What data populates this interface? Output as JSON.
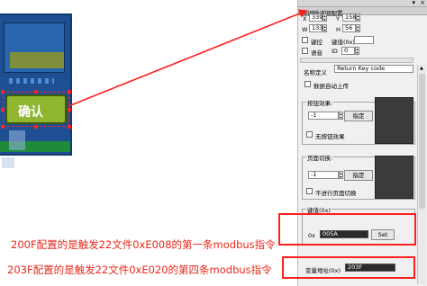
{
  "canvas": {
    "confirm_label": "确认",
    "caption_1": "200F配置的是触发22文件0xE008的第一条modbus指令",
    "caption_2": "203F配置的是触发22文件0xE020的第四条modbus指令"
  },
  "panel": {
    "pin_icon": "▾",
    "close_icon": "×",
    "title": "按键输返回配置",
    "x_label": "X",
    "x_value": "339",
    "y_label": "Y",
    "y_value": "158",
    "w_label": "W",
    "w_value": "133",
    "h_label": "H",
    "h_value": "56",
    "keyboard_label": "键控",
    "keyvalue_label": "键值(0x)",
    "voice_label": "语音",
    "id_label": "ID",
    "id_value": "0",
    "name_label": "名称定义",
    "name_value": "Return Key code",
    "auto_upload_label": "数据自动上传",
    "button_effect_title": "按钮效果:",
    "button_effect_value": "-1",
    "button_effect_btn": "指定",
    "no_button_effect_label": "无按钮效果",
    "page_switch_title": "页面切换:",
    "page_switch_value": "-1",
    "page_switch_btn": "指定",
    "no_page_switch_label": "不进行页面切换",
    "key_value_title": "键值(0x)",
    "key_value_prefix": "0x",
    "key_value": "005A",
    "key_value_btn": "Set",
    "var_addr_label": "变量地址(0x)",
    "var_addr_value": "203F"
  },
  "colors": {
    "annotation_red": "#ff1f1f",
    "caption_red": "#e8281c",
    "confirm_green": "#8fb62e"
  }
}
